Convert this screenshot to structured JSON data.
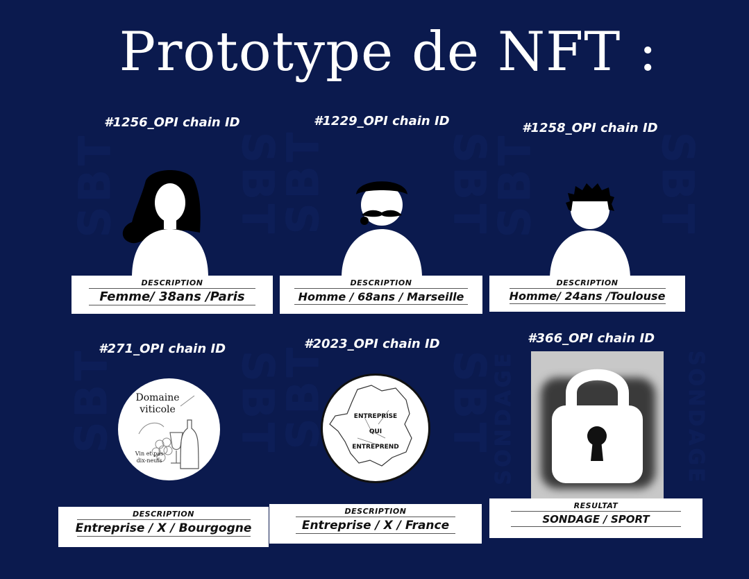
{
  "title": "Prototype de NFT :",
  "watermarks": {
    "sbt": "SBT",
    "sondage": "SONDAGE"
  },
  "nfts": [
    {
      "chain_id": "#1256_OPI chain ID",
      "label": "DESCRIPTION",
      "value": "Femme/ 38ans /Paris",
      "avatar": "woman-long-hair-icon"
    },
    {
      "chain_id": "#1229_OPI chain ID",
      "label": "DESCRIPTION",
      "value": "Homme / 68ans / Marseille",
      "avatar": "man-beret-mustache-icon"
    },
    {
      "chain_id": "#1258_OPI chain ID",
      "label": "DESCRIPTION",
      "value": "Homme/ 24ans /Toulouse",
      "avatar": "man-curly-hair-icon"
    },
    {
      "chain_id": "#271_OPI chain ID",
      "label": "DESCRIPTION",
      "value": "Entreprise / X / Bourgogne",
      "badge_title": "Domaine viticole",
      "badge_line1": "Domaine",
      "badge_line2": "viticole",
      "badge_sub1": "Vin et pas",
      "badge_sub2": "dix-neufs",
      "avatar": "wine-badge-icon"
    },
    {
      "chain_id": "#2023_OPI chain ID",
      "label": "DESCRIPTION",
      "value": "Entreprise / X / France",
      "badge_line1": "ENTREPRISE",
      "badge_line2": "QUI",
      "badge_line3": "ENTREPREND",
      "avatar": "france-map-badge-icon"
    },
    {
      "chain_id": "#366_OPI chain ID",
      "label": "RESULTAT",
      "value": "SONDAGE / SPORT",
      "avatar": "padlock-icon"
    }
  ],
  "colors": {
    "background": "#0b1a4e",
    "card": "#ffffff",
    "text": "#111111"
  }
}
